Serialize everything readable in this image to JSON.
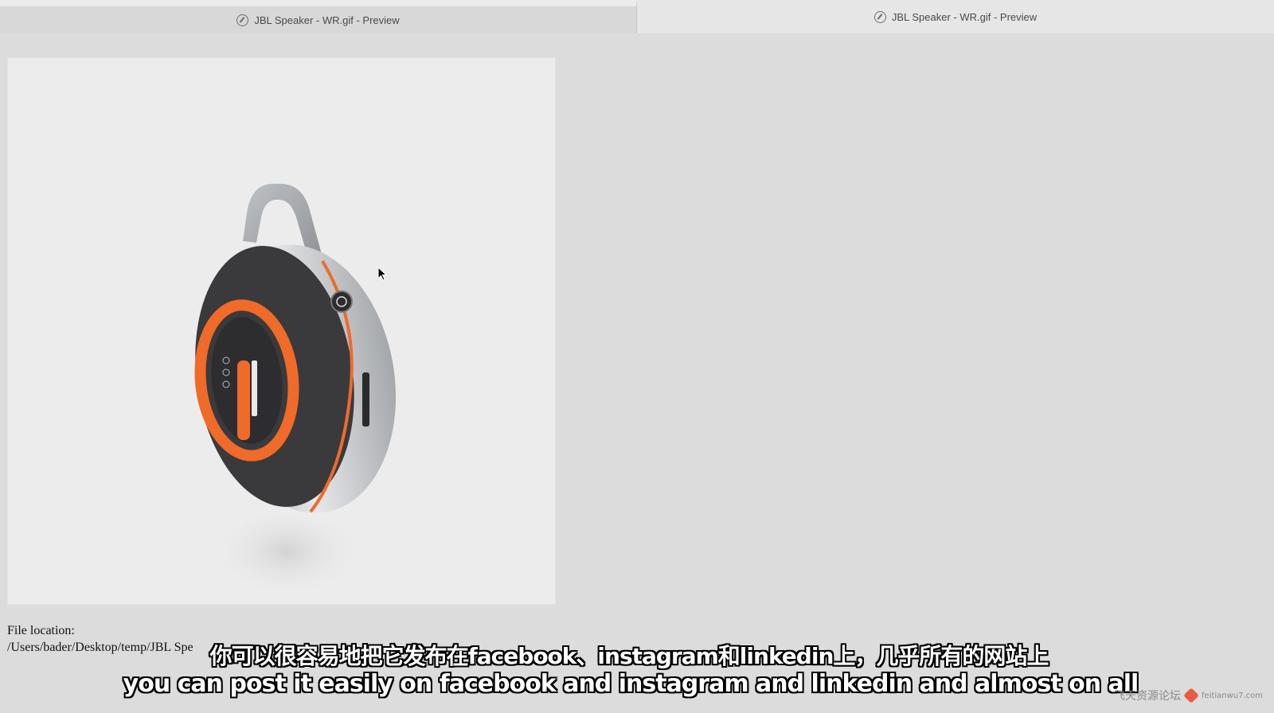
{
  "tabs": [
    {
      "title": "JBL Speaker - WR.gif - Preview",
      "state": "active",
      "icon": "preview-compass-icon"
    },
    {
      "title": "JBL Speaker - WR.gif - Preview",
      "state": "inactive",
      "icon": "preview-compass-icon"
    }
  ],
  "file_info": {
    "label": "File location:",
    "path": "/Users/bader/Desktop/temp/JBL Spe"
  },
  "subtitles": {
    "zh": "你可以很容易地把它发布在facebook、instagram和linkedin上，几乎所有的网站上",
    "en": "you can post it easily on facebook and instagram and linkedin and almost on all"
  },
  "watermark": {
    "text": "飞天资源论坛",
    "url": "feitianwu7.com"
  },
  "colors": {
    "accent_orange": "#f06a2a",
    "speaker_dark": "#3a3a3c",
    "speaker_silver": "#c8cacc"
  }
}
